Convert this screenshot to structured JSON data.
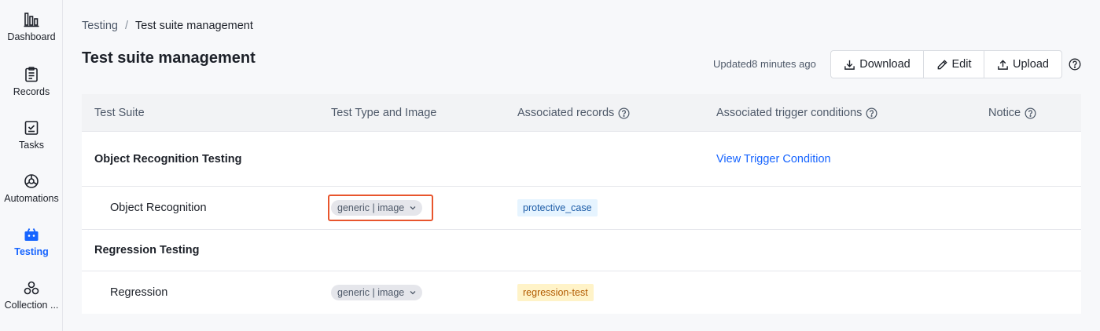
{
  "colors": {
    "accent": "#1664ff",
    "highlight_border": "#e8552d",
    "tag_blue_bg": "#e6f4ff",
    "tag_orange_bg": "#fff3c8"
  },
  "sidebar": {
    "items": [
      {
        "label": "Dashboard",
        "icon": "bar-chart-icon",
        "active": false
      },
      {
        "label": "Records",
        "icon": "clipboard-icon",
        "active": false
      },
      {
        "label": "Tasks",
        "icon": "task-checklist-icon",
        "active": false
      },
      {
        "label": "Automations",
        "icon": "automation-icon",
        "active": false
      },
      {
        "label": "Testing",
        "icon": "testing-icon",
        "active": true
      },
      {
        "label": "Collection ...",
        "icon": "collection-icon",
        "active": false
      }
    ]
  },
  "breadcrumb": {
    "parent": "Testing",
    "separator": "/",
    "current": "Test suite management"
  },
  "page": {
    "title": "Test suite management",
    "updated": "Updated8 minutes ago"
  },
  "toolbar": {
    "download_label": "Download",
    "edit_label": "Edit",
    "upload_label": "Upload"
  },
  "table": {
    "headers": [
      "Test Suite",
      "Test Type and Image",
      "Associated records",
      "Associated trigger conditions",
      "Notice"
    ],
    "groups": [
      {
        "name": "Object Recognition Testing",
        "trigger_link": "View Trigger Condition",
        "suite": {
          "name": "Object Recognition",
          "type": "generic | image",
          "record": "protective_case",
          "record_color": "blue"
        }
      },
      {
        "name": "Regression Testing",
        "trigger_link": "",
        "suite": {
          "name": "Regression",
          "type": "generic | image",
          "record": "regression-test",
          "record_color": "orange"
        }
      }
    ]
  }
}
